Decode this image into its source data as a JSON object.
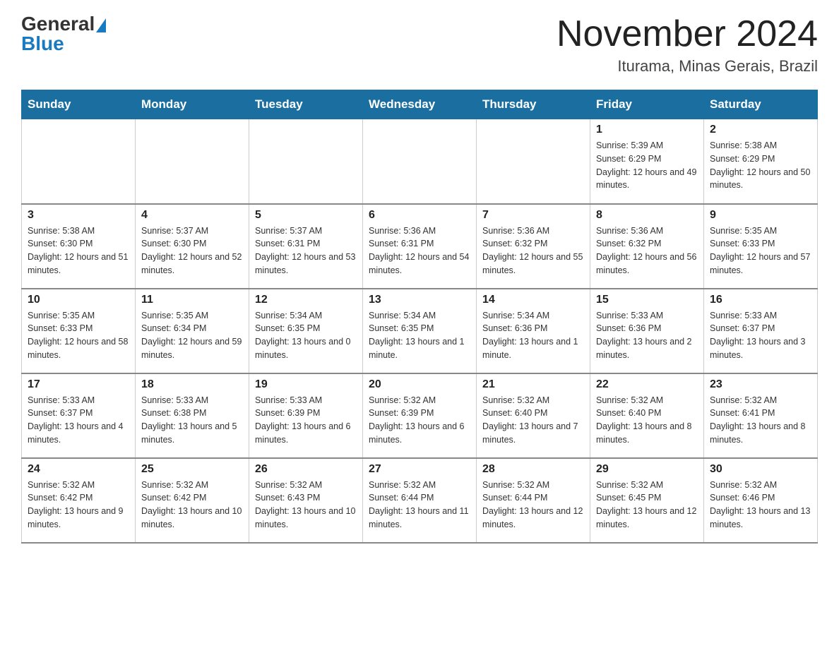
{
  "header": {
    "logo_general": "General",
    "logo_blue": "Blue",
    "title": "November 2024",
    "location": "Iturama, Minas Gerais, Brazil"
  },
  "weekdays": [
    "Sunday",
    "Monday",
    "Tuesday",
    "Wednesday",
    "Thursday",
    "Friday",
    "Saturday"
  ],
  "weeks": [
    [
      {
        "day": "",
        "info": ""
      },
      {
        "day": "",
        "info": ""
      },
      {
        "day": "",
        "info": ""
      },
      {
        "day": "",
        "info": ""
      },
      {
        "day": "",
        "info": ""
      },
      {
        "day": "1",
        "info": "Sunrise: 5:39 AM\nSunset: 6:29 PM\nDaylight: 12 hours and 49 minutes."
      },
      {
        "day": "2",
        "info": "Sunrise: 5:38 AM\nSunset: 6:29 PM\nDaylight: 12 hours and 50 minutes."
      }
    ],
    [
      {
        "day": "3",
        "info": "Sunrise: 5:38 AM\nSunset: 6:30 PM\nDaylight: 12 hours and 51 minutes."
      },
      {
        "day": "4",
        "info": "Sunrise: 5:37 AM\nSunset: 6:30 PM\nDaylight: 12 hours and 52 minutes."
      },
      {
        "day": "5",
        "info": "Sunrise: 5:37 AM\nSunset: 6:31 PM\nDaylight: 12 hours and 53 minutes."
      },
      {
        "day": "6",
        "info": "Sunrise: 5:36 AM\nSunset: 6:31 PM\nDaylight: 12 hours and 54 minutes."
      },
      {
        "day": "7",
        "info": "Sunrise: 5:36 AM\nSunset: 6:32 PM\nDaylight: 12 hours and 55 minutes."
      },
      {
        "day": "8",
        "info": "Sunrise: 5:36 AM\nSunset: 6:32 PM\nDaylight: 12 hours and 56 minutes."
      },
      {
        "day": "9",
        "info": "Sunrise: 5:35 AM\nSunset: 6:33 PM\nDaylight: 12 hours and 57 minutes."
      }
    ],
    [
      {
        "day": "10",
        "info": "Sunrise: 5:35 AM\nSunset: 6:33 PM\nDaylight: 12 hours and 58 minutes."
      },
      {
        "day": "11",
        "info": "Sunrise: 5:35 AM\nSunset: 6:34 PM\nDaylight: 12 hours and 59 minutes."
      },
      {
        "day": "12",
        "info": "Sunrise: 5:34 AM\nSunset: 6:35 PM\nDaylight: 13 hours and 0 minutes."
      },
      {
        "day": "13",
        "info": "Sunrise: 5:34 AM\nSunset: 6:35 PM\nDaylight: 13 hours and 1 minute."
      },
      {
        "day": "14",
        "info": "Sunrise: 5:34 AM\nSunset: 6:36 PM\nDaylight: 13 hours and 1 minute."
      },
      {
        "day": "15",
        "info": "Sunrise: 5:33 AM\nSunset: 6:36 PM\nDaylight: 13 hours and 2 minutes."
      },
      {
        "day": "16",
        "info": "Sunrise: 5:33 AM\nSunset: 6:37 PM\nDaylight: 13 hours and 3 minutes."
      }
    ],
    [
      {
        "day": "17",
        "info": "Sunrise: 5:33 AM\nSunset: 6:37 PM\nDaylight: 13 hours and 4 minutes."
      },
      {
        "day": "18",
        "info": "Sunrise: 5:33 AM\nSunset: 6:38 PM\nDaylight: 13 hours and 5 minutes."
      },
      {
        "day": "19",
        "info": "Sunrise: 5:33 AM\nSunset: 6:39 PM\nDaylight: 13 hours and 6 minutes."
      },
      {
        "day": "20",
        "info": "Sunrise: 5:32 AM\nSunset: 6:39 PM\nDaylight: 13 hours and 6 minutes."
      },
      {
        "day": "21",
        "info": "Sunrise: 5:32 AM\nSunset: 6:40 PM\nDaylight: 13 hours and 7 minutes."
      },
      {
        "day": "22",
        "info": "Sunrise: 5:32 AM\nSunset: 6:40 PM\nDaylight: 13 hours and 8 minutes."
      },
      {
        "day": "23",
        "info": "Sunrise: 5:32 AM\nSunset: 6:41 PM\nDaylight: 13 hours and 8 minutes."
      }
    ],
    [
      {
        "day": "24",
        "info": "Sunrise: 5:32 AM\nSunset: 6:42 PM\nDaylight: 13 hours and 9 minutes."
      },
      {
        "day": "25",
        "info": "Sunrise: 5:32 AM\nSunset: 6:42 PM\nDaylight: 13 hours and 10 minutes."
      },
      {
        "day": "26",
        "info": "Sunrise: 5:32 AM\nSunset: 6:43 PM\nDaylight: 13 hours and 10 minutes."
      },
      {
        "day": "27",
        "info": "Sunrise: 5:32 AM\nSunset: 6:44 PM\nDaylight: 13 hours and 11 minutes."
      },
      {
        "day": "28",
        "info": "Sunrise: 5:32 AM\nSunset: 6:44 PM\nDaylight: 13 hours and 12 minutes."
      },
      {
        "day": "29",
        "info": "Sunrise: 5:32 AM\nSunset: 6:45 PM\nDaylight: 13 hours and 12 minutes."
      },
      {
        "day": "30",
        "info": "Sunrise: 5:32 AM\nSunset: 6:46 PM\nDaylight: 13 hours and 13 minutes."
      }
    ]
  ]
}
